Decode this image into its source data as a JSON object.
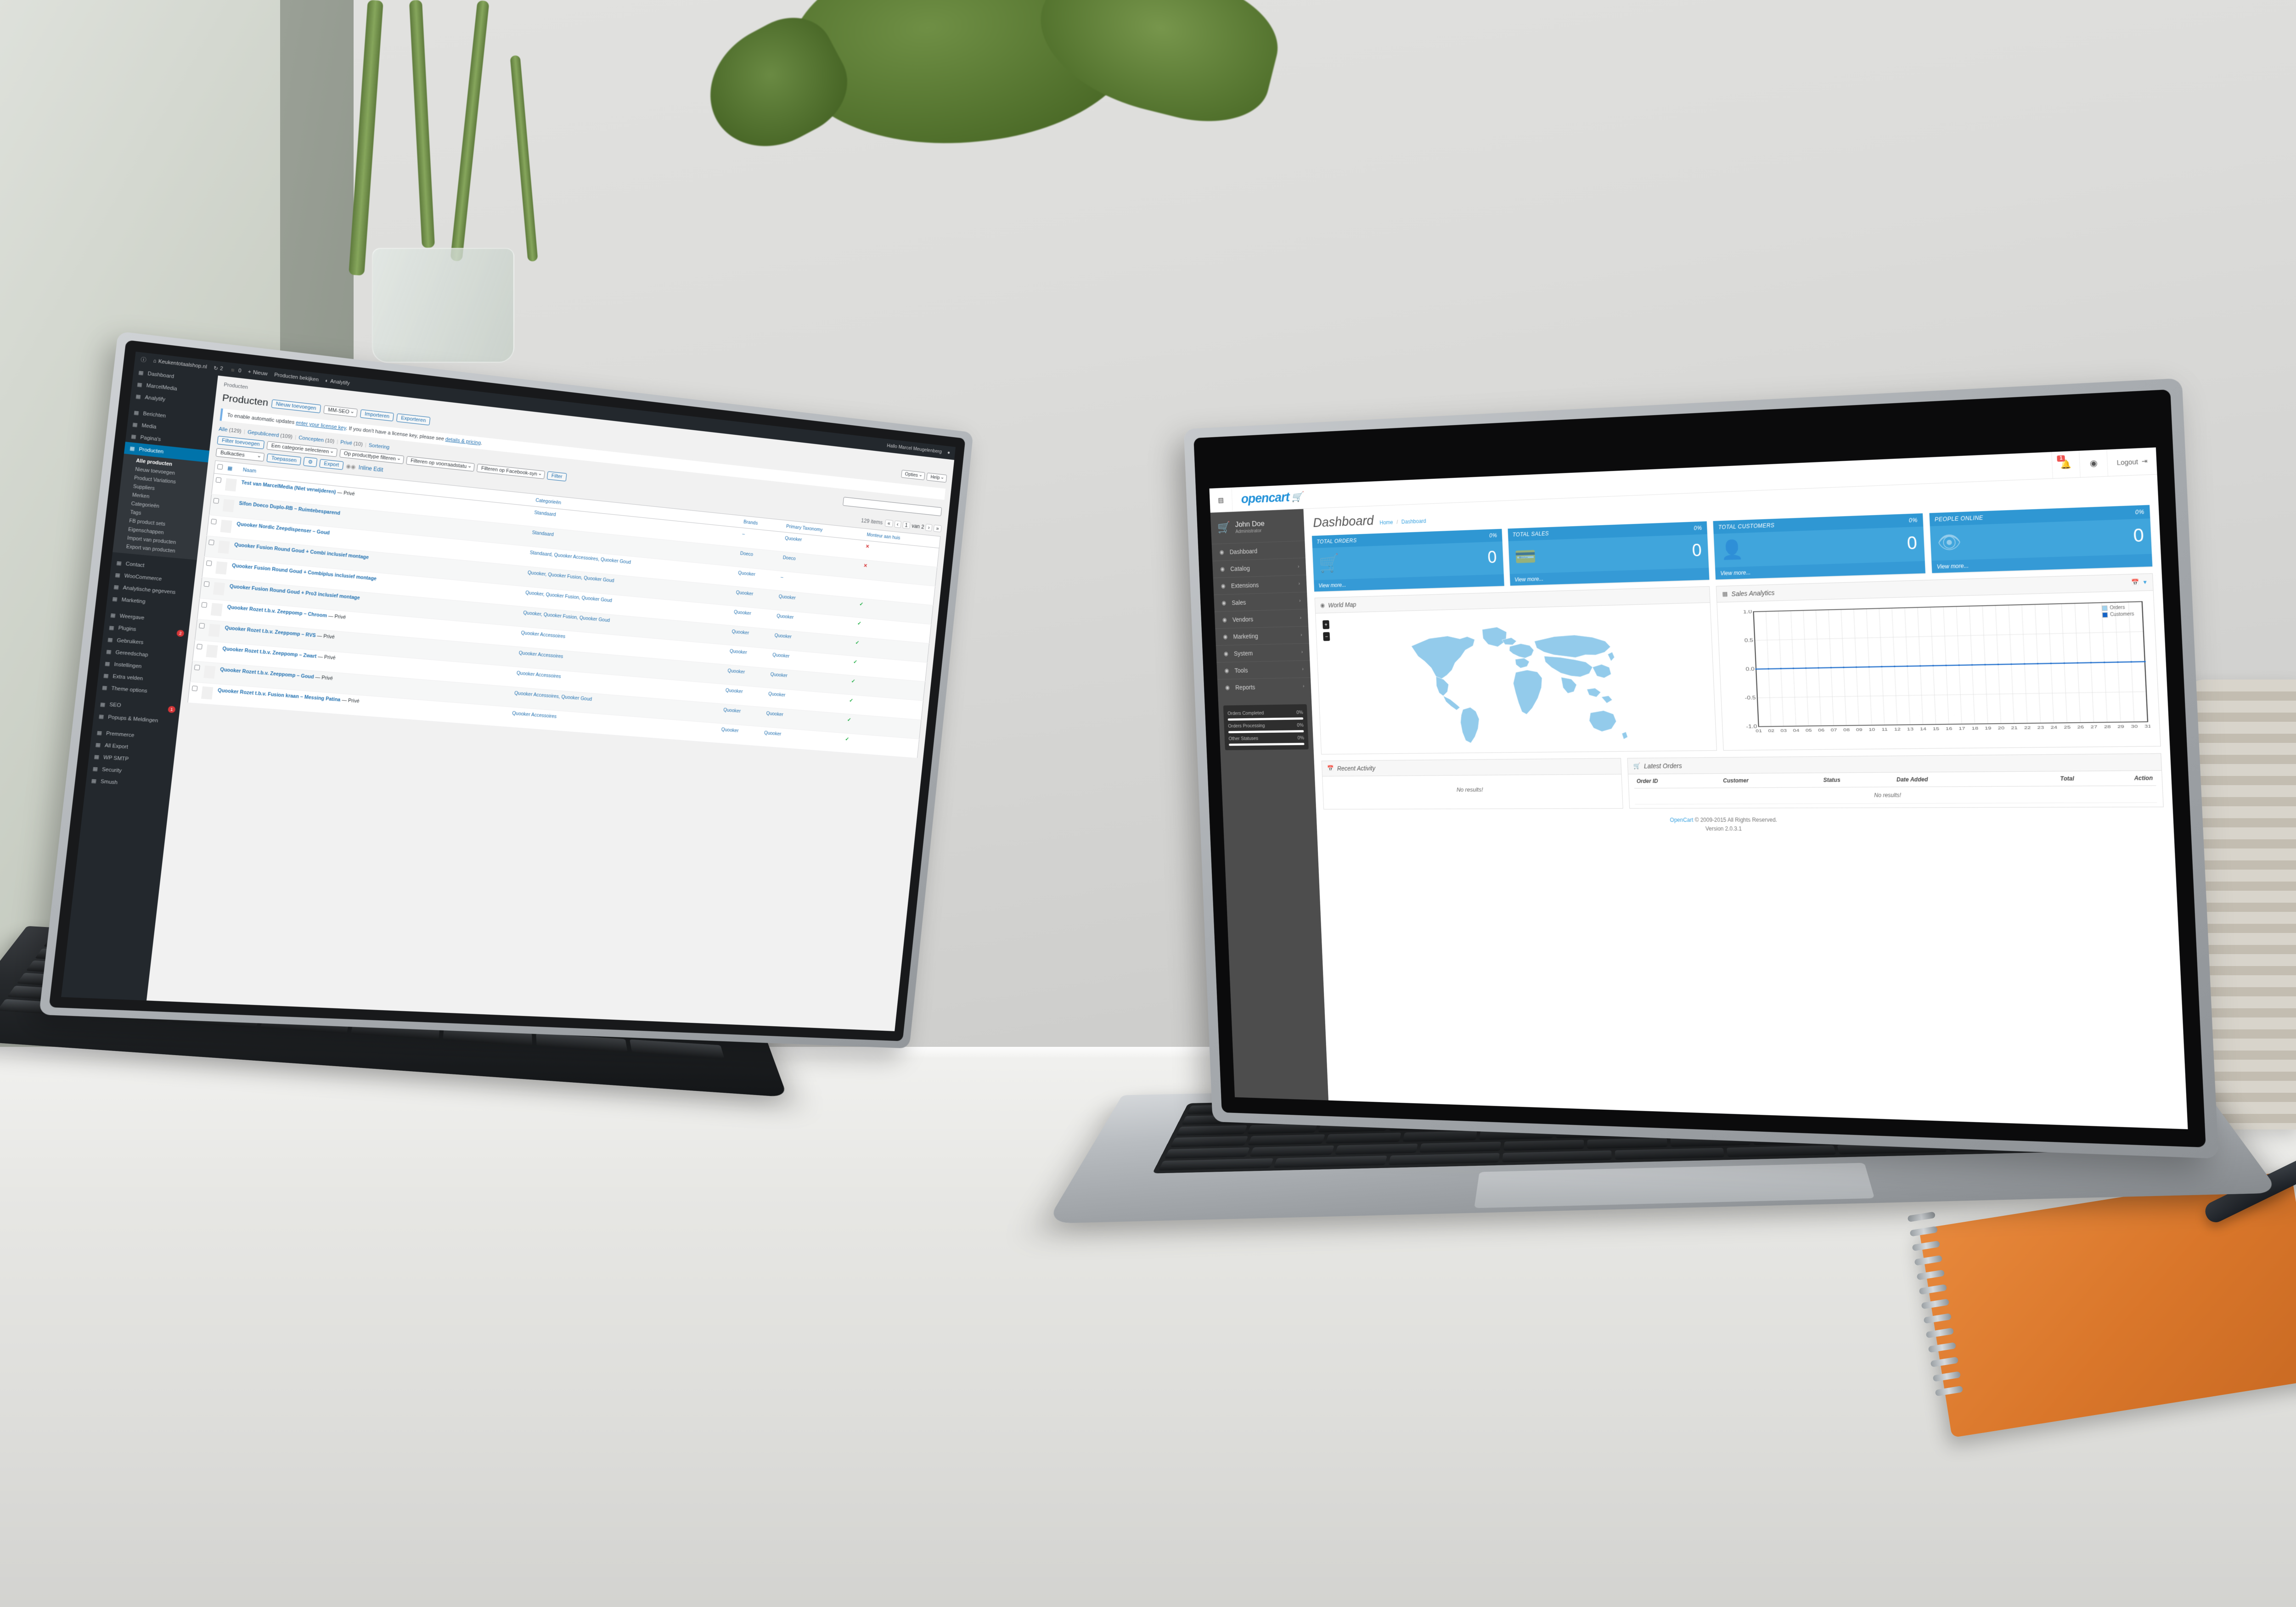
{
  "scene": {
    "description": "Two devices on a white desk: a MacBook on the right showing the OpenCart admin dashboard and a tablet with keyboard on the left showing a WordPress WooCommerce products list"
  },
  "opencart": {
    "header": {
      "hamburger_icon": "list-icon",
      "logo_text": "opencart",
      "logo_cart_icon": "cart-icon",
      "notification_icon": "bell-icon",
      "notification_count": "1",
      "help_icon": "lifebuoy-icon",
      "logout_label": "Logout",
      "logout_icon": "sign-out-icon"
    },
    "profile": {
      "avatar_icon": "cart-avatar-icon",
      "name": "John Doe",
      "role": "Administrator"
    },
    "nav": [
      {
        "label": "Dashboard",
        "icon": "dashboard-icon",
        "caret": ""
      },
      {
        "label": "Catalog",
        "icon": "tag-icon",
        "caret": "›"
      },
      {
        "label": "Extensions",
        "icon": "puzzle-icon",
        "caret": "›"
      },
      {
        "label": "Sales",
        "icon": "cart-icon",
        "caret": "›"
      },
      {
        "label": "Vendors",
        "icon": "users-icon",
        "caret": "›"
      },
      {
        "label": "Marketing",
        "icon": "share-icon",
        "caret": "›"
      },
      {
        "label": "System",
        "icon": "gear-icon",
        "caret": "›"
      },
      {
        "label": "Tools",
        "icon": "wrench-icon",
        "caret": "›"
      },
      {
        "label": "Reports",
        "icon": "bar-chart-icon",
        "caret": "›"
      }
    ],
    "order_stats": [
      {
        "label": "Orders Completed",
        "value": "0%",
        "pct": 100
      },
      {
        "label": "Orders Processing",
        "value": "0%",
        "pct": 100
      },
      {
        "label": "Other Statuses",
        "value": "0%",
        "pct": 100
      }
    ],
    "page": {
      "title": "Dashboard",
      "breadcrumb_home": "Home",
      "breadcrumb_sep": "/",
      "breadcrumb_current": "Dashboard"
    },
    "cards": [
      {
        "title": "TOTAL ORDERS",
        "pct": "0%",
        "value": "0",
        "icon": "cart-icon",
        "footer": "View more..."
      },
      {
        "title": "TOTAL SALES",
        "pct": "0%",
        "value": "0",
        "icon": "credit-card-icon",
        "footer": "View more..."
      },
      {
        "title": "TOTAL CUSTOMERS",
        "pct": "0%",
        "value": "0",
        "icon": "user-icon",
        "footer": "View more..."
      },
      {
        "title": "PEOPLE ONLINE",
        "pct": "0%",
        "value": "0",
        "icon": "eye-icon",
        "footer": "View more..."
      }
    ],
    "world_map": {
      "title": "World Map",
      "icon": "globe-icon",
      "zoom_in": "+",
      "zoom_out": "−"
    },
    "sales_analytics": {
      "title": "Sales Analytics",
      "icon": "bar-chart-icon",
      "calendar_icon": "calendar-icon",
      "caret_icon": "chevron-down-icon"
    },
    "recent_activity": {
      "title": "Recent Activity",
      "icon": "calendar-icon",
      "empty": "No results!"
    },
    "latest_orders": {
      "title": "Latest Orders",
      "icon": "cart-icon",
      "columns": [
        "Order ID",
        "Customer",
        "Status",
        "Date Added",
        "Total",
        "Action"
      ],
      "empty": "No results!"
    },
    "footer": {
      "brand": "OpenCart",
      "copyright": "© 2009-2015 All Rights Reserved.",
      "version": "Version 2.0.3.1"
    },
    "colors": {
      "accent": "#40a5dc",
      "accent_dark": "#2f97d3",
      "sidebar": "#4d4d4d",
      "badge": "#ef5350"
    },
    "chart_data": {
      "type": "line",
      "title": "Sales Analytics",
      "xlabel": "",
      "ylabel": "",
      "x": [
        "01",
        "02",
        "03",
        "04",
        "05",
        "06",
        "07",
        "08",
        "09",
        "10",
        "11",
        "12",
        "13",
        "14",
        "15",
        "16",
        "17",
        "18",
        "19",
        "20",
        "21",
        "22",
        "23",
        "24",
        "25",
        "26",
        "27",
        "28",
        "29",
        "30",
        "31"
      ],
      "ytick_labels": [
        "1.0",
        "0.5",
        "0.0",
        "-0.5",
        "-1.0"
      ],
      "ylim": [
        -1.0,
        1.0
      ],
      "grid": true,
      "legend_position": "top-right",
      "series": [
        {
          "name": "Orders",
          "color": "#9fd3f0",
          "values": [
            0,
            0,
            0,
            0,
            0,
            0,
            0,
            0,
            0,
            0,
            0,
            0,
            0,
            0,
            0,
            0,
            0,
            0,
            0,
            0,
            0,
            0,
            0,
            0,
            0,
            0,
            0,
            0,
            0,
            0,
            0
          ]
        },
        {
          "name": "Customers",
          "color": "#1464c8",
          "values": [
            0,
            0,
            0,
            0,
            0,
            0,
            0,
            0,
            0,
            0,
            0,
            0,
            0,
            0,
            0,
            0,
            0,
            0,
            0,
            0,
            0,
            0,
            0,
            0,
            0,
            0,
            0,
            0,
            0,
            0,
            0
          ]
        }
      ]
    }
  },
  "wordpress": {
    "adminbar": {
      "wp_logo_icon": "wordpress-icon",
      "site_icon": "home-icon",
      "site_name": "Keukentotaalshop.nl",
      "updates_icon": "update-icon",
      "updates_count": "2",
      "comments_icon": "comment-icon",
      "comments_count": "0",
      "new_icon": "plus-icon",
      "new_label": "Nieuw",
      "view_products_label": "Producten bekijken",
      "analytify_icon": "analytify-icon",
      "analytify_label": "Analytify",
      "greeting": "Hallo Marcel Meugelenberg",
      "avatar_icon": "avatar-icon"
    },
    "screen_options": {
      "label": "Opties",
      "help_label": "Help",
      "icon": "screen-options-icon"
    },
    "sidebar": [
      {
        "label": "Dashboard",
        "icon": "dashboard-icon"
      },
      {
        "label": "MarcelMedia",
        "icon": "gear-icon"
      },
      {
        "label": "Analytify",
        "icon": "analytify-icon"
      },
      {
        "label": "Berichten",
        "icon": "pin-icon",
        "space_before": true
      },
      {
        "label": "Media",
        "icon": "media-icon"
      },
      {
        "label": "Pagina's",
        "icon": "page-icon"
      },
      {
        "label": "Producten",
        "icon": "product-icon",
        "active": true
      },
      {
        "label": "Contact",
        "icon": "mail-icon",
        "space_before": true
      },
      {
        "label": "WooCommerce",
        "icon": "woocommerce-icon"
      },
      {
        "label": "Analytische gegevens",
        "icon": "chart-icon"
      },
      {
        "label": "Marketing",
        "icon": "megaphone-icon"
      },
      {
        "label": "Weergave",
        "icon": "brush-icon",
        "space_before": true
      },
      {
        "label": "Plugins",
        "icon": "plug-icon",
        "count": "2"
      },
      {
        "label": "Gebruikers",
        "icon": "user-icon"
      },
      {
        "label": "Gereedschap",
        "icon": "wrench-icon"
      },
      {
        "label": "Instellingen",
        "icon": "settings-icon"
      },
      {
        "label": "Extra velden",
        "icon": "fields-icon"
      },
      {
        "label": "Theme options",
        "icon": "gear-icon"
      },
      {
        "label": "SEO",
        "icon": "seo-icon",
        "count": "1",
        "space_before": true
      },
      {
        "label": "Popups & Meldingen",
        "icon": "popup-icon"
      },
      {
        "label": "Premmerce",
        "icon": "cart-icon",
        "space_before": true
      },
      {
        "label": "All Export",
        "icon": "export-icon"
      },
      {
        "label": "WP SMTP",
        "icon": "gear-icon"
      },
      {
        "label": "Security",
        "icon": "shield-icon"
      },
      {
        "label": "Smush",
        "icon": "smush-icon"
      }
    ],
    "producten_submenu": [
      {
        "label": "Alle producten",
        "current": true
      },
      {
        "label": "Nieuw toevoegen"
      },
      {
        "label": "Product Variations"
      },
      {
        "label": "Suppliers"
      },
      {
        "label": "Merken"
      },
      {
        "label": "Categorieën"
      },
      {
        "label": "Tags"
      },
      {
        "label": "FB product sets"
      },
      {
        "label": "Eigenschappen"
      },
      {
        "label": "Import van producten"
      },
      {
        "label": "Export van producten"
      }
    ],
    "breadcrumb": "Producten",
    "page_title": "Producten",
    "title_actions": [
      {
        "label": "Nieuw toevoegen",
        "type": "button"
      },
      {
        "label": "MM-SEO",
        "type": "select"
      },
      {
        "label": "Importeren",
        "type": "button"
      },
      {
        "label": "Exporteren",
        "type": "button"
      }
    ],
    "notice": {
      "text_before": "To enable automatic updates ",
      "link1": "enter your license key",
      "text_middle": ". If you don't have a license key, please see ",
      "link2": "details & pricing",
      "text_after": "."
    },
    "subsubsub": [
      {
        "label": "Alle",
        "count": "(129)"
      },
      {
        "label": "Gepubliceerd",
        "count": "(109)"
      },
      {
        "label": "Concepten",
        "count": "(10)"
      },
      {
        "label": "Privé",
        "count": "(10)"
      },
      {
        "label": "Sortering",
        "count": ""
      }
    ],
    "filters": [
      {
        "label": "Filter toevoegen",
        "type": "button"
      },
      {
        "label": "Een categorie selecteren",
        "type": "select"
      },
      {
        "label": "Op producttype filteren",
        "type": "select"
      },
      {
        "label": "Filteren op voorraadstatu",
        "type": "select"
      },
      {
        "label": "Filteren op Facebook-syn",
        "type": "select"
      },
      {
        "label": "Filter",
        "type": "button"
      }
    ],
    "bulk": {
      "select_label": "Bulkacties",
      "apply_label": "Toepassen",
      "gear_icon": "gear-icon",
      "export_label": "Export",
      "toggle_icon": "toggle-icon",
      "inline_edit_label": "Inline Edit"
    },
    "listing_meta": {
      "items_label": "129 items",
      "page_current": "1",
      "page_of": "van",
      "page_total": "2"
    },
    "table": {
      "columns": [
        "Naam",
        "Categorieën",
        "Brands",
        "Primary Taxonomy",
        "Monteur aan huis"
      ],
      "rows": [
        {
          "name": "Test van MarcelMedia (Niet verwijderen)",
          "suffix": "— Privé",
          "categories": "Standaard",
          "brands": "–",
          "taxonomy": "Quooker",
          "monteur": "x"
        },
        {
          "name": "Sifon Doeco Duplo-RB – Ruimtebesparend",
          "suffix": "",
          "categories": "Standaard",
          "brands": "Doeco",
          "taxonomy": "Doeco",
          "monteur": "x"
        },
        {
          "name": "Quooker Nordic Zeepdispenser – Goud",
          "suffix": "",
          "categories": "Standaard, Quooker Accessoires, Quooker Goud",
          "brands": "Quooker",
          "taxonomy": "–",
          "monteur": ""
        },
        {
          "name": "Quooker Fusion Round Goud + Combi inclusief montage",
          "suffix": "",
          "categories": "Quooker, Quooker Fusion, Quooker Goud",
          "brands": "Quooker",
          "taxonomy": "Quooker",
          "monteur": "✓"
        },
        {
          "name": "Quooker Fusion Round Goud + Combiplus inclusief montage",
          "suffix": "",
          "categories": "Quooker, Quooker Fusion, Quooker Goud",
          "brands": "Quooker",
          "taxonomy": "Quooker",
          "monteur": "✓"
        },
        {
          "name": "Quooker Fusion Round Goud + Pro3 inclusief montage",
          "suffix": "",
          "categories": "Quooker, Quooker Fusion, Quooker Goud",
          "brands": "Quooker",
          "taxonomy": "Quooker",
          "monteur": "✓"
        },
        {
          "name": "Quooker Rozet t.b.v. Zeeppomp – Chroom",
          "suffix": "— Privé",
          "categories": "Quooker Accessoires",
          "brands": "Quooker",
          "taxonomy": "Quooker",
          "monteur": "✓"
        },
        {
          "name": "Quooker Rozet t.b.v. Zeeppomp – RVS",
          "suffix": "— Privé",
          "categories": "Quooker Accessoires",
          "brands": "Quooker",
          "taxonomy": "Quooker",
          "monteur": "✓"
        },
        {
          "name": "Quooker Rozet t.b.v. Zeeppomp – Zwart",
          "suffix": "— Privé",
          "categories": "Quooker Accessoires",
          "brands": "Quooker",
          "taxonomy": "Quooker",
          "monteur": "✓"
        },
        {
          "name": "Quooker Rozet t.b.v. Zeeppomp – Goud",
          "suffix": "— Privé",
          "categories": "Quooker Accessoires, Quooker Goud",
          "brands": "Quooker",
          "taxonomy": "Quooker",
          "monteur": "✓"
        },
        {
          "name": "Quooker Rozet t.b.v. Fusion kraan – Messing Patina",
          "suffix": "— Privé",
          "categories": "Quooker Accessoires",
          "brands": "Quooker",
          "taxonomy": "Quooker",
          "monteur": "✓"
        }
      ]
    }
  }
}
